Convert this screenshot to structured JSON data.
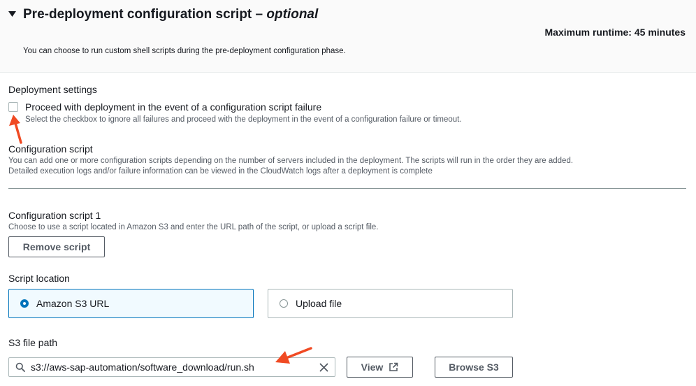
{
  "section": {
    "title": "Pre-deployment configuration script",
    "title_separator": " – ",
    "title_optional": "optional",
    "runtime": "Maximum runtime: 45 minutes",
    "description": "You can choose to run custom shell scripts during the pre-deployment configuration phase."
  },
  "deployment_settings": {
    "heading": "Deployment settings",
    "checkbox_label": "Proceed with deployment in the event of a configuration script failure",
    "checkbox_checked": false,
    "checkbox_help": "Select the checkbox to ignore all failures and proceed with the deployment in the event of a configuration failure or timeout."
  },
  "configuration_script": {
    "heading": "Configuration script",
    "desc_line1": "You can add one or more configuration scripts depending on the number of servers included in the deployment. The scripts will run in the order they are added.",
    "desc_line2": "Detailed execution logs and/or failure information can be viewed in the CloudWatch logs after a deployment is complete"
  },
  "script1": {
    "heading": "Configuration script 1",
    "description": "Choose to use a script located in Amazon S3 and enter the URL path of the script, or upload a script file.",
    "remove_label": "Remove script"
  },
  "script_location": {
    "heading": "Script location",
    "options": [
      {
        "label": "Amazon S3 URL",
        "selected": true
      },
      {
        "label": "Upload file",
        "selected": false
      }
    ]
  },
  "s3_path": {
    "heading": "S3 file path",
    "value": "s3://aws-sap-automation/software_download/run.sh",
    "view_label": "View",
    "browse_label": "Browse S3"
  },
  "colors": {
    "accent": "#0073bb",
    "annotation_arrow": "#f04a23"
  },
  "icons": [
    "caret-down-icon",
    "search-icon",
    "clear-icon",
    "external-link-icon"
  ]
}
